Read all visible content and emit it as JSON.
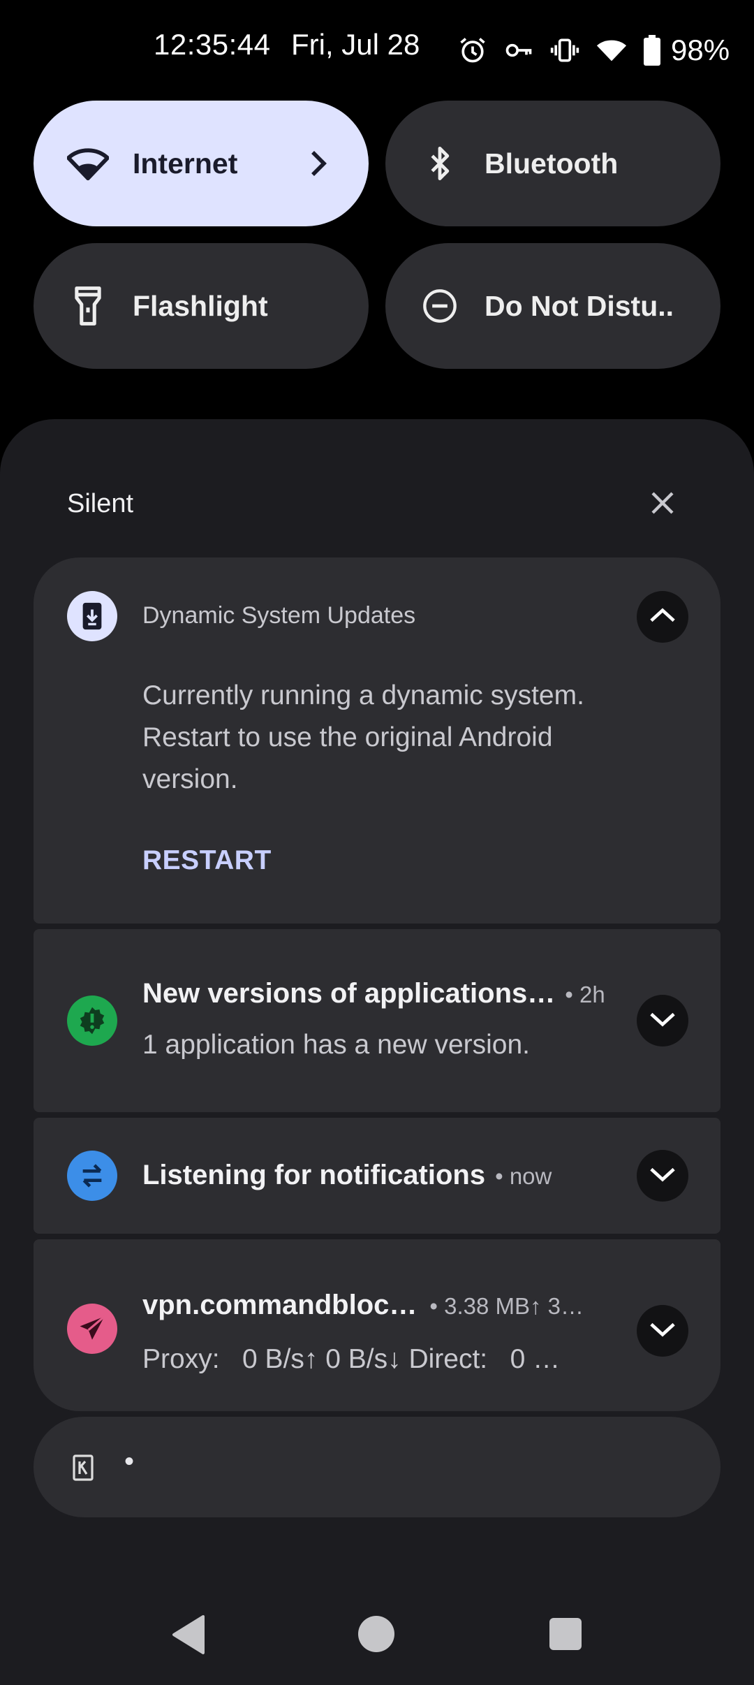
{
  "status_bar": {
    "time": "12:35:44",
    "date": "Fri, Jul 28",
    "icons": [
      "alarm-icon",
      "vpn-key-icon",
      "vibrate-icon",
      "wifi-icon",
      "battery-icon"
    ],
    "battery": "98%"
  },
  "quick_settings": {
    "tiles": [
      {
        "label": "Internet",
        "icon": "wifi-icon",
        "active": true
      },
      {
        "label": "Bluetooth",
        "icon": "bluetooth-icon",
        "active": false
      },
      {
        "label": "Flashlight",
        "icon": "flashlight-icon",
        "active": false
      },
      {
        "label": "Do Not Distu..",
        "icon": "do-not-disturb-icon",
        "active": false
      }
    ]
  },
  "shade": {
    "section_label": "Silent",
    "notifications": [
      {
        "app": "Dynamic System Updates",
        "body": "Currently running a dynamic system. Restart to use the original Android version.",
        "action": "RESTART",
        "icon": "system-update-icon"
      },
      {
        "title": "New versions of applications…",
        "time": "• 2h",
        "text": "1 application has a new version.",
        "icon": "alert-gear-icon"
      },
      {
        "title": "Listening for notifications",
        "time": "• now",
        "icon": "swap-arrows-icon"
      },
      {
        "title": "vpn.commandbloc…",
        "meta": "• 3.38 MB↑ 3…",
        "text": "Proxy:   0 B/s↑ 0 B/s↓ Direct:   0 …",
        "icon": "send-icon"
      }
    ],
    "mini_row": {
      "dot": "•",
      "icon": "app-square-icon"
    }
  },
  "colors": {
    "active_tile": "#dfe3ff",
    "tile": "#2d2d31",
    "shade": "#1c1c20",
    "green_app": "#1ea84f",
    "blue_app": "#3c8ee8",
    "pink_app": "#e55c8a",
    "accent_text": "#c8cfff"
  }
}
